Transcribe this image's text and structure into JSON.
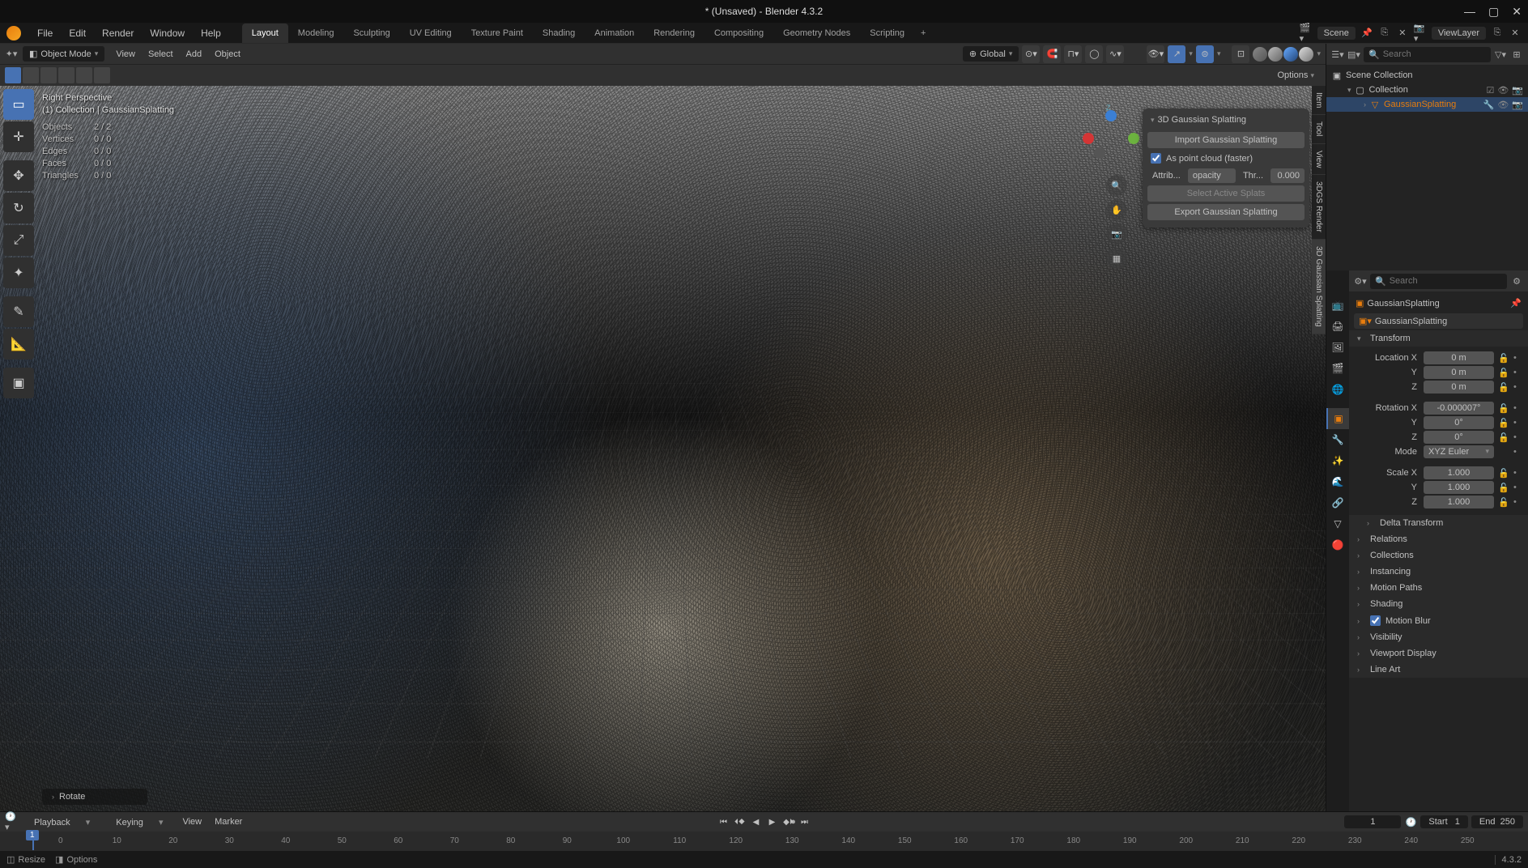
{
  "window": {
    "title": "* (Unsaved) - Blender 4.3.2"
  },
  "topmenu": {
    "file": "File",
    "edit": "Edit",
    "render": "Render",
    "window": "Window",
    "help": "Help"
  },
  "workspaces": [
    "Layout",
    "Modeling",
    "Sculpting",
    "UV Editing",
    "Texture Paint",
    "Shading",
    "Animation",
    "Rendering",
    "Compositing",
    "Geometry Nodes",
    "Scripting"
  ],
  "active_workspace": "Layout",
  "scene": {
    "label": "Scene"
  },
  "viewlayer": {
    "label": "ViewLayer"
  },
  "viewport_header": {
    "mode": "Object Mode",
    "menus": [
      "View",
      "Select",
      "Add",
      "Object"
    ],
    "orientation": "Global",
    "options": "Options"
  },
  "overlay": {
    "view_label": "Right Perspective",
    "collection_label": "(1) Collection | GaussianSplatting",
    "stats": {
      "objects": {
        "label": "Objects",
        "value": "2 / 2"
      },
      "vertices": {
        "label": "Vertices",
        "value": "0 / 0"
      },
      "edges": {
        "label": "Edges",
        "value": "0 / 0"
      },
      "faces": {
        "label": "Faces",
        "value": "0 / 0"
      },
      "triangles": {
        "label": "Triangles",
        "value": "0 / 0"
      }
    },
    "last_op": "Rotate"
  },
  "npanel_tabs": [
    "Item",
    "Tool",
    "View",
    "3DGS Render",
    "3D Gaussian Splatting"
  ],
  "gs_panel": {
    "title": "3D Gaussian Splatting",
    "import_btn": "Import Gaussian Splatting",
    "checkbox": "As point cloud (faster)",
    "attrib_label": "Attrib...",
    "attrib_value": "opacity",
    "thr_label": "Thr...",
    "thr_value": "0.000",
    "select_btn": "Select Active Splats",
    "export_btn": "Export Gaussian Splatting"
  },
  "outliner": {
    "search_placeholder": "Search",
    "scene_collection": "Scene Collection",
    "collection": "Collection",
    "gaussian": "GaussianSplatting"
  },
  "properties": {
    "search_placeholder": "Search",
    "breadcrumb": "GaussianSplatting",
    "datablock": "GaussianSplatting",
    "transform": {
      "title": "Transform",
      "loc_x": {
        "label": "Location X",
        "value": "0 m"
      },
      "loc_y": {
        "label": "Y",
        "value": "0 m"
      },
      "loc_z": {
        "label": "Z",
        "value": "0 m"
      },
      "rot_x": {
        "label": "Rotation X",
        "value": "-0.000007°"
      },
      "rot_y": {
        "label": "Y",
        "value": "0°"
      },
      "rot_z": {
        "label": "Z",
        "value": "0°"
      },
      "mode": {
        "label": "Mode",
        "value": "XYZ Euler"
      },
      "scale_x": {
        "label": "Scale X",
        "value": "1.000"
      },
      "scale_y": {
        "label": "Y",
        "value": "1.000"
      },
      "scale_z": {
        "label": "Z",
        "value": "1.000"
      }
    },
    "sections": [
      "Delta Transform",
      "Relations",
      "Collections",
      "Instancing",
      "Motion Paths",
      "Shading",
      "Motion Blur",
      "Visibility",
      "Viewport Display",
      "Line Art"
    ]
  },
  "timeline": {
    "menus": [
      "Playback",
      "Keying",
      "View",
      "Marker"
    ],
    "current_frame": "1",
    "start_label": "Start",
    "start_value": "1",
    "end_label": "End",
    "end_value": "250",
    "ticks": [
      "0",
      "10",
      "20",
      "30",
      "40",
      "50",
      "60",
      "70",
      "80",
      "90",
      "100",
      "110",
      "120",
      "130",
      "140",
      "150",
      "160",
      "170",
      "180",
      "190",
      "200",
      "210",
      "220",
      "230",
      "240",
      "250"
    ]
  },
  "statusbar": {
    "resize": "Resize",
    "options": "Options",
    "version": "4.3.2"
  }
}
